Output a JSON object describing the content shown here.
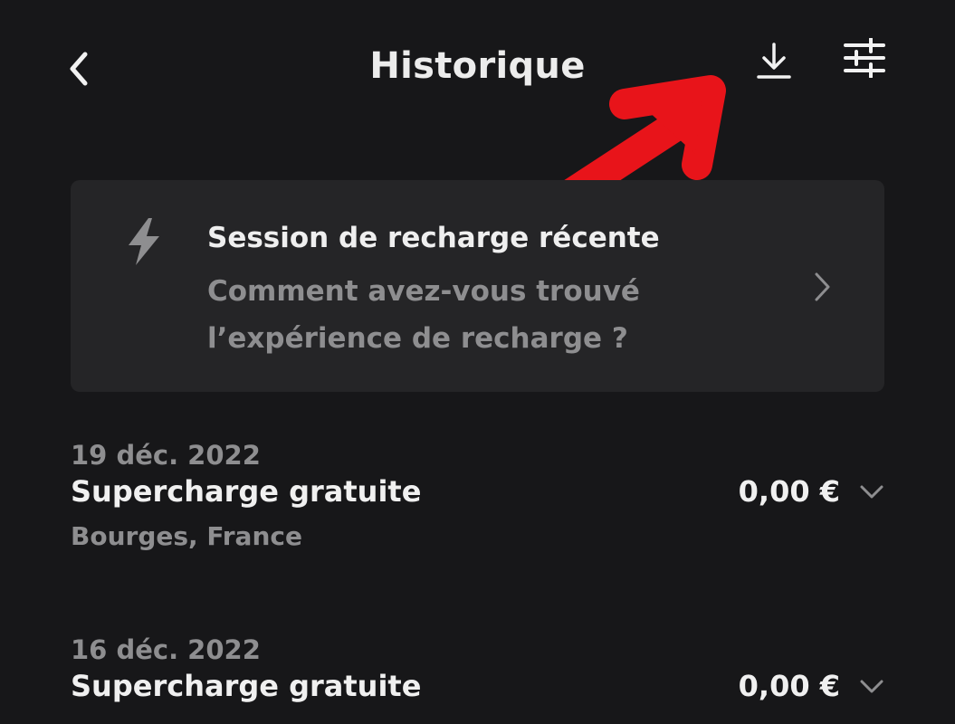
{
  "header": {
    "title": "Historique",
    "back_icon": "chevron-left-icon",
    "download_icon": "download-icon",
    "filter_icon": "sliders-icon"
  },
  "banner": {
    "icon": "lightning-bolt-icon",
    "title": "Session de recharge récente",
    "subtitle": "Comment avez-vous trouvé l’expérience de recharge ?",
    "chevron_icon": "chevron-right-icon"
  },
  "entries": [
    {
      "date": "19 déc. 2022",
      "title": "Supercharge gratuite",
      "amount": "0,00 €",
      "location": "Bourges, France"
    },
    {
      "date": "16 déc. 2022",
      "title": "Supercharge gratuite",
      "amount": "0,00 €",
      "location": ""
    }
  ],
  "colors": {
    "background": "#171719",
    "card": "#252527",
    "text_primary": "#f0f0f0",
    "text_secondary": "#8e8e90",
    "annotation_arrow": "#e8141a"
  }
}
